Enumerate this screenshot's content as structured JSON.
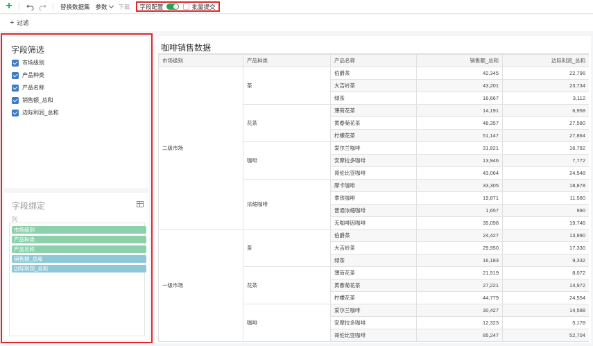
{
  "toolbar": {
    "replace_dataset": "替换数据集",
    "params": "参数",
    "download": "下载",
    "field_config": "字段配置",
    "batch_submit": "批量提交"
  },
  "filterbar": {
    "filter": "过滤"
  },
  "field_filter": {
    "title": "字段筛选",
    "items": [
      "市场级别",
      "产品种类",
      "产品名称",
      "销售额_总和",
      "边际利润_总和"
    ]
  },
  "field_bind": {
    "title": "字段绑定",
    "sub": "列",
    "tags": [
      "市场级别",
      "产品种类",
      "产品名称",
      "销售额_总和",
      "边际利润_总和"
    ]
  },
  "report": {
    "title": "咖啡销售数据",
    "headers": [
      "市场级别",
      "产品种类",
      "产品名称",
      "销售额_总和",
      "边际利润_总和"
    ],
    "groups": [
      {
        "market": "二级市场",
        "categories": [
          {
            "name": "茶",
            "rows": [
              [
                "伯爵茶",
                "42,345",
                "22,796"
              ],
              [
                "大吉岭茶",
                "43,201",
                "23,734"
              ],
              [
                "绿茶",
                "16,667",
                "3,112"
              ]
            ]
          },
          {
            "name": "花茶",
            "rows": [
              [
                "薄荷花茶",
                "14,191",
                "6,958"
              ],
              [
                "黄春菊花茶",
                "48,357",
                "27,580"
              ],
              [
                "柠檬花茶",
                "51,147",
                "27,864"
              ]
            ]
          },
          {
            "name": "咖啡",
            "rows": [
              [
                "爱尔兰咖啡",
                "31,821",
                "16,782"
              ],
              [
                "安摩拉多咖啡",
                "13,946",
                "7,772"
              ],
              [
                "哥伦比亚咖啡",
                "43,064",
                "24,548"
              ]
            ]
          },
          {
            "name": "浓缩咖啡",
            "rows": [
              [
                "摩卡咖啡",
                "33,305",
                "18,878"
              ],
              [
                "拿铁咖啡",
                "19,871",
                "11,580"
              ],
              [
                "普通浓缩咖啡",
                "1,657",
                "990"
              ],
              [
                "无咖啡因咖啡",
                "35,098",
                "19,746"
              ]
            ]
          }
        ]
      },
      {
        "market": "一级市场",
        "categories": [
          {
            "name": "茶",
            "rows": [
              [
                "伯爵茶",
                "24,427",
                "13,990"
              ],
              [
                "大吉岭茶",
                "29,950",
                "17,330"
              ],
              [
                "绿茶",
                "16,183",
                "9,332"
              ]
            ]
          },
          {
            "name": "花茶",
            "rows": [
              [
                "薄荷花茶",
                "21,519",
                "8,072"
              ],
              [
                "黄春菊花茶",
                "27,221",
                "14,972"
              ],
              [
                "柠檬花茶",
                "44,779",
                "24,554"
              ]
            ]
          },
          {
            "name": "咖啡",
            "rows": [
              [
                "爱尔兰咖啡",
                "30,427",
                "14,588"
              ],
              [
                "安摩拉多咖啡",
                "12,323",
                "5,178"
              ],
              [
                "哥伦比亚咖啡",
                "85,247",
                "52,704"
              ]
            ]
          }
        ]
      }
    ]
  }
}
